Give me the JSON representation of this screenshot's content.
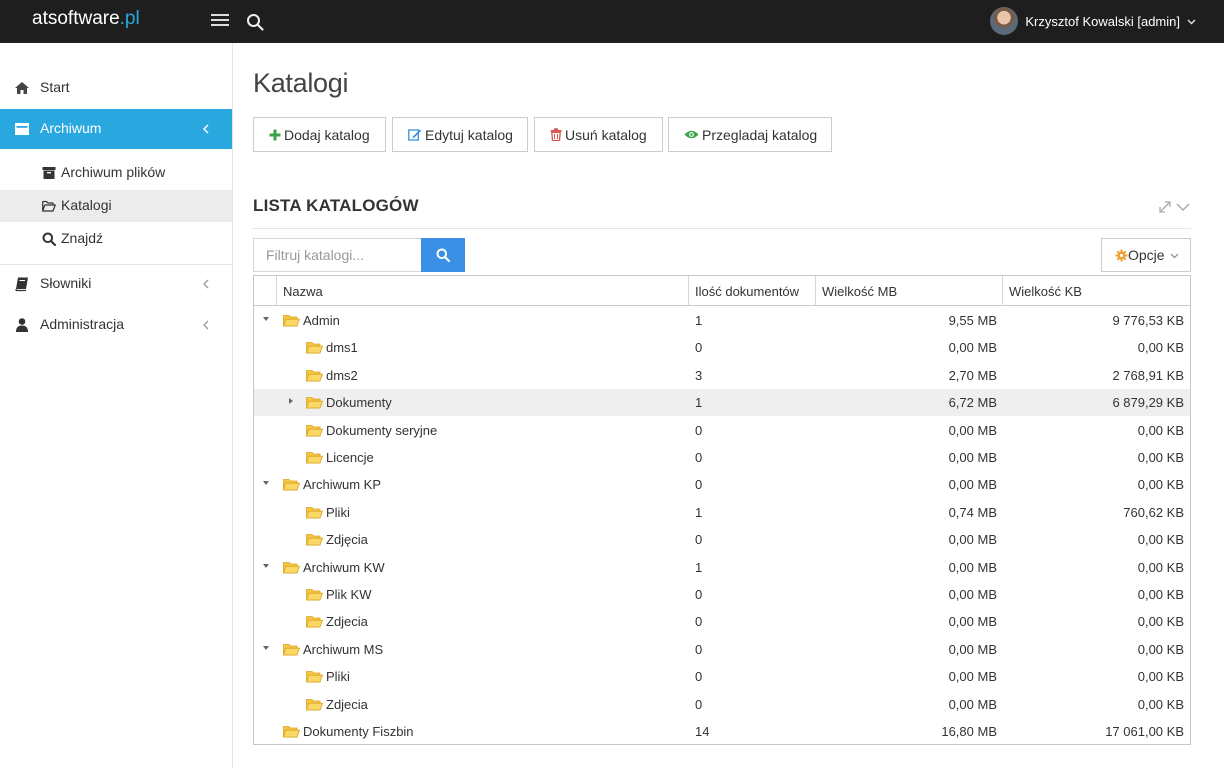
{
  "brand": {
    "name": "atsoftware",
    "suffix": ".pl"
  },
  "user": {
    "name": "Krzysztof Kowalski [admin]"
  },
  "sidebar": {
    "items": [
      {
        "label": "Start",
        "icon": "home-icon"
      },
      {
        "label": "Archiwum",
        "icon": "archive-icon",
        "active": true
      },
      {
        "label": "Słowniki",
        "icon": "book-icon"
      },
      {
        "label": "Administracja",
        "icon": "user-icon"
      }
    ],
    "subitems": [
      {
        "label": "Archiwum plików",
        "icon": "archive-box-icon"
      },
      {
        "label": "Katalogi",
        "icon": "folder-open-icon",
        "selected": true
      },
      {
        "label": "Znajdź",
        "icon": "search-icon"
      }
    ]
  },
  "main": {
    "title": "Katalogi",
    "toolbar": {
      "add": "Dodaj katalog",
      "edit": "Edytuj katalog",
      "delete": "Usuń katalog",
      "view": "Przegladaj katalog"
    },
    "section_title": "LISTA KATALOGÓW",
    "filter_placeholder": "Filtruj katalogi...",
    "options_label": "Opcje"
  },
  "colors": {
    "accent": "#29a8e0",
    "topbar": "#1e1e1e",
    "search_button": "#3b8fe4",
    "add_green": "#3aa34a",
    "delete_red": "#d9534f",
    "folder_yellow": "#f6c544"
  },
  "table": {
    "columns": [
      "Nazwa",
      "Ilość dokumentów",
      "Wielkość MB",
      "Wielkość KB"
    ],
    "rows": [
      {
        "name": "Admin",
        "level": 0,
        "toggle": "expanded",
        "docs": "1",
        "mb": "9,55 MB",
        "kb": "9 776,53 KB"
      },
      {
        "name": "dms1",
        "level": 1,
        "toggle": "",
        "docs": "0",
        "mb": "0,00 MB",
        "kb": "0,00 KB"
      },
      {
        "name": "dms2",
        "level": 1,
        "toggle": "",
        "docs": "3",
        "mb": "2,70 MB",
        "kb": "2 768,91 KB"
      },
      {
        "name": "Dokumenty",
        "level": 1,
        "toggle": "collapsed",
        "docs": "1",
        "mb": "6,72 MB",
        "kb": "6 879,29 KB",
        "highlight": true
      },
      {
        "name": "Dokumenty seryjne",
        "level": 1,
        "toggle": "",
        "docs": "0",
        "mb": "0,00 MB",
        "kb": "0,00 KB"
      },
      {
        "name": "Licencje",
        "level": 1,
        "toggle": "",
        "docs": "0",
        "mb": "0,00 MB",
        "kb": "0,00 KB"
      },
      {
        "name": "Archiwum KP",
        "level": 0,
        "toggle": "expanded",
        "docs": "0",
        "mb": "0,00 MB",
        "kb": "0,00 KB"
      },
      {
        "name": "Pliki",
        "level": 1,
        "toggle": "",
        "docs": "1",
        "mb": "0,74 MB",
        "kb": "760,62 KB"
      },
      {
        "name": "Zdjęcia",
        "level": 1,
        "toggle": "",
        "docs": "0",
        "mb": "0,00 MB",
        "kb": "0,00 KB"
      },
      {
        "name": "Archiwum KW",
        "level": 0,
        "toggle": "expanded",
        "docs": "1",
        "mb": "0,00 MB",
        "kb": "0,00 KB"
      },
      {
        "name": "Plik KW",
        "level": 1,
        "toggle": "",
        "docs": "0",
        "mb": "0,00 MB",
        "kb": "0,00 KB"
      },
      {
        "name": "Zdjecia",
        "level": 1,
        "toggle": "",
        "docs": "0",
        "mb": "0,00 MB",
        "kb": "0,00 KB"
      },
      {
        "name": "Archiwum MS",
        "level": 0,
        "toggle": "expanded",
        "docs": "0",
        "mb": "0,00 MB",
        "kb": "0,00 KB"
      },
      {
        "name": "Pliki",
        "level": 1,
        "toggle": "",
        "docs": "0",
        "mb": "0,00 MB",
        "kb": "0,00 KB"
      },
      {
        "name": "Zdjecia",
        "level": 1,
        "toggle": "",
        "docs": "0",
        "mb": "0,00 MB",
        "kb": "0,00 KB"
      },
      {
        "name": "Dokumenty Fiszbin",
        "level": 0,
        "toggle": "",
        "docs": "14",
        "mb": "16,80 MB",
        "kb": "17 061,00 KB"
      }
    ]
  }
}
